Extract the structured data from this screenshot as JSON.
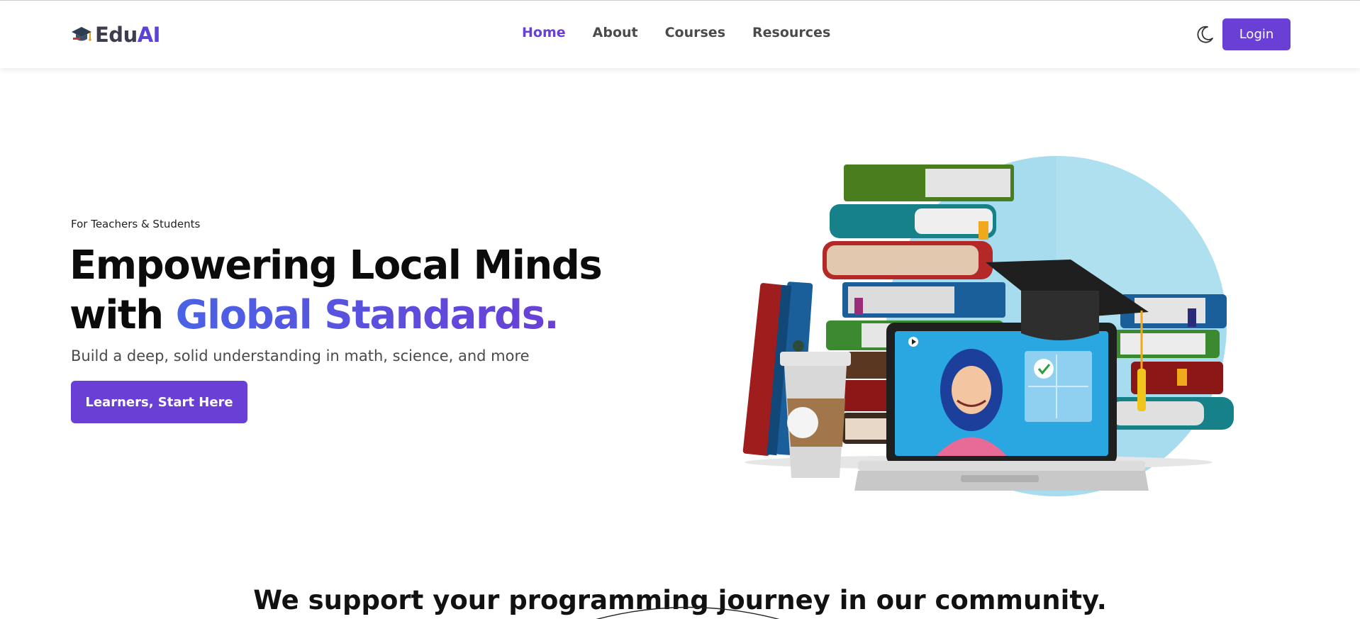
{
  "brand": {
    "name_part1": "Edu",
    "name_part2": "AI",
    "icon": "graduation-cap-icon",
    "accent_color": "#5b43d6"
  },
  "nav": {
    "items": [
      {
        "label": "Home",
        "active": true
      },
      {
        "label": "About",
        "active": false
      },
      {
        "label": "Courses",
        "active": false
      },
      {
        "label": "Resources",
        "active": false
      }
    ],
    "theme_toggle_icon": "moon-icon",
    "login_label": "Login",
    "primary_color": "#6a3fd6"
  },
  "hero": {
    "tagline": "For Teachers & Students",
    "headline_line1": "Empowering Local Minds",
    "headline_line2_prefix": "with ",
    "headline_line2_accent": "Global Standards.",
    "subtitle": "Build a deep, solid understanding in math, science, and more",
    "cta_label": "Learners, Start Here",
    "illustration": "books-laptop-graduation-illustration"
  },
  "section": {
    "community_heading": "We support your programming journey in our community."
  }
}
